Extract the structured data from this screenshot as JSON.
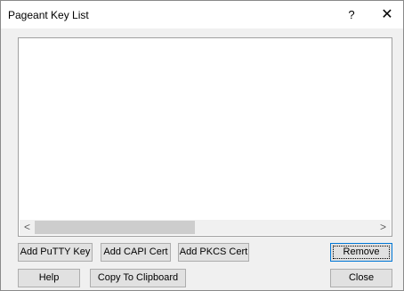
{
  "window": {
    "title": "Pageant Key List",
    "help_glyph": "?",
    "close_glyph": "✕"
  },
  "keylist": {
    "items": [],
    "scroll_left_glyph": "<",
    "scroll_right_glyph": ">"
  },
  "buttons": {
    "add_putty_key": "Add PuTTY Key",
    "add_capi_cert": "Add CAPI Cert",
    "add_pkcs_cert": "Add PKCS Cert",
    "remove": "Remove",
    "help": "Help",
    "copy_to_clipboard": "Copy To Clipboard",
    "close": "Close"
  }
}
